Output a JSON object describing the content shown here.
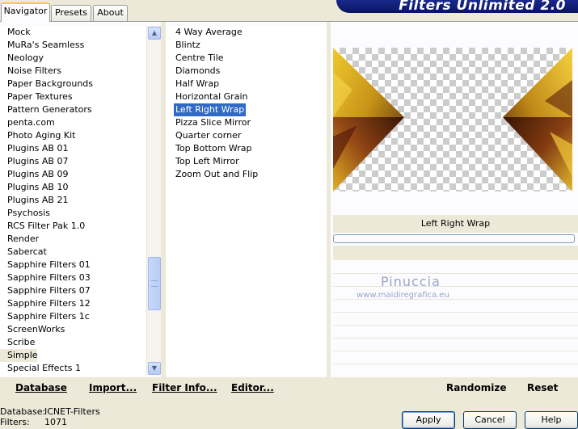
{
  "tabs": [
    {
      "label": "Navigator"
    },
    {
      "label": "Presets"
    },
    {
      "label": "About"
    }
  ],
  "banner_title": "Filters Unlimited 2.0",
  "categories": [
    "Mock",
    "MuRa's Seamless",
    "Neology",
    "Noise Filters",
    "Paper Backgrounds",
    "Paper Textures",
    "Pattern Generators",
    "penta.com",
    "Photo Aging Kit",
    "Plugins AB 01",
    "Plugins AB 07",
    "Plugins AB 09",
    "Plugins AB 10",
    "Plugins AB 21",
    "Psychosis",
    "RCS Filter Pak 1.0",
    "Render",
    "Sabercat",
    "Sapphire Filters 01",
    "Sapphire Filters 03",
    "Sapphire Filters 07",
    "Sapphire Filters 12",
    "Sapphire Filters 1c",
    "ScreenWorks",
    "Scribe",
    "Simple",
    "Special Effects 1"
  ],
  "selected_category": "Simple",
  "filters": [
    "4 Way Average",
    "Blintz",
    "Centre Tile",
    "Diamonds",
    "Half Wrap",
    "Horizontal Grain",
    "Left Right Wrap",
    "Pizza Slice Mirror",
    "Quarter corner",
    "Top Bottom Wrap",
    "Top Left Mirror",
    "Zoom Out and Flip"
  ],
  "selected_filter": "Left Right Wrap",
  "preview_filter_name": "Left Right Wrap",
  "watermark": {
    "name": "Pinuccia",
    "url": "www.maidiregrafica.eu"
  },
  "bottom_links": {
    "database": "Database",
    "import": "Import...",
    "filter_info": "Filter Info...",
    "editor": "Editor...",
    "randomize": "Randomize",
    "reset": "Reset"
  },
  "status": {
    "database_label": "Database:",
    "database_value": "ICNET-Filters",
    "filters_label": "Filters:",
    "filters_value": "1071"
  },
  "buttons": {
    "apply": "Apply",
    "cancel": "Cancel",
    "help": "Help"
  },
  "colors": {
    "selection": "#316AC5",
    "banner": "#0A1460",
    "gold": "#D4A420",
    "dark_brown": "#4A1A0A"
  }
}
